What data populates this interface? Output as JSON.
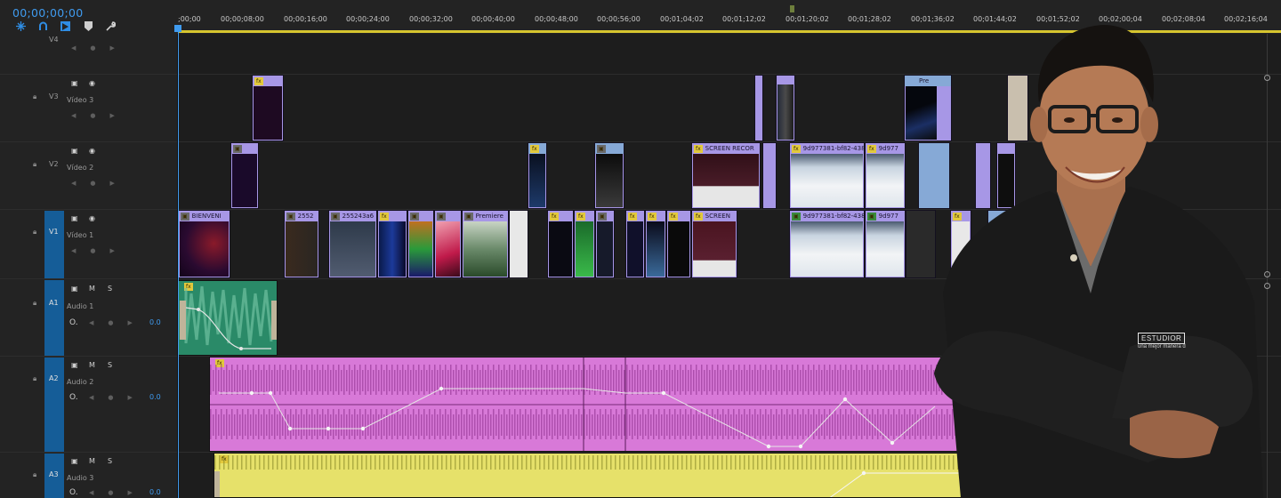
{
  "timeline": {
    "timecode": "00;00;00;00",
    "ruler_ticks": [
      ";00;00",
      "00;00;08;00",
      "00;00;16;00",
      "00;00;24;00",
      "00;00;32;00",
      "00;00;40;00",
      "00;00;48;00",
      "00;00;56;00",
      "00;01;04;02",
      "00;01;12;02",
      "00;01;20;02",
      "00;01;28;02",
      "00;01;36;02",
      "00;01;44;02",
      "00;01;52;02",
      "00;02;00;04",
      "00;02;08;04",
      "00;02;16;04"
    ]
  },
  "toolbar": {
    "snap_icon": "snap-icon",
    "linked_selection_icon": "magnet-icon",
    "insert_icon": "insert-icon",
    "marker_icon": "marker-icon",
    "settings_icon": "wrench-icon"
  },
  "tracks": {
    "v4": {
      "id": "V4",
      "name": ""
    },
    "v3": {
      "id": "V3",
      "name": "Vídeo 3"
    },
    "v2": {
      "id": "V2",
      "name": "Vídeo 2"
    },
    "v1": {
      "id": "V1",
      "name": "Vídeo 1"
    },
    "a1": {
      "id": "A1",
      "name": "Audio 1",
      "mute": "M",
      "solo": "S",
      "vol": "O.",
      "level": "0.0"
    },
    "a2": {
      "id": "A2",
      "name": "Audio 2",
      "mute": "M",
      "solo": "S",
      "vol": "O.",
      "level": "0.0"
    },
    "a3": {
      "id": "A3",
      "name": "Audio 3",
      "mute": "M",
      "solo": "S",
      "vol": "O.",
      "level": "0.0"
    }
  },
  "clips": {
    "v3_pre": "Pre",
    "v2_screen": "SCREEN RECOR",
    "v2_9d_a": "9d977381-bf82-438",
    "v2_9d_b": "9d977",
    "v1_bienveni": "BIENVENI",
    "v1_2552": "2552",
    "v1_255243a": "255243a6",
    "v1_premiere": "Premiere",
    "v1_screen": "SCREEN",
    "v1_9d_a": "9d977381-bf82-438",
    "v1_9d_b": "9d977",
    "fx": "fx"
  },
  "badge": {
    "line1": "ESTUDIOR",
    "line2": "una mejor manera d"
  },
  "colors": {
    "accent": "#3f9bef",
    "video_clip": "#a797e6",
    "audio_a1": "#2a8a68",
    "audio_a2": "#d879d8",
    "audio_a3": "#e6e16a",
    "workarea": "#d6c52f",
    "track_target": "#155d98"
  }
}
